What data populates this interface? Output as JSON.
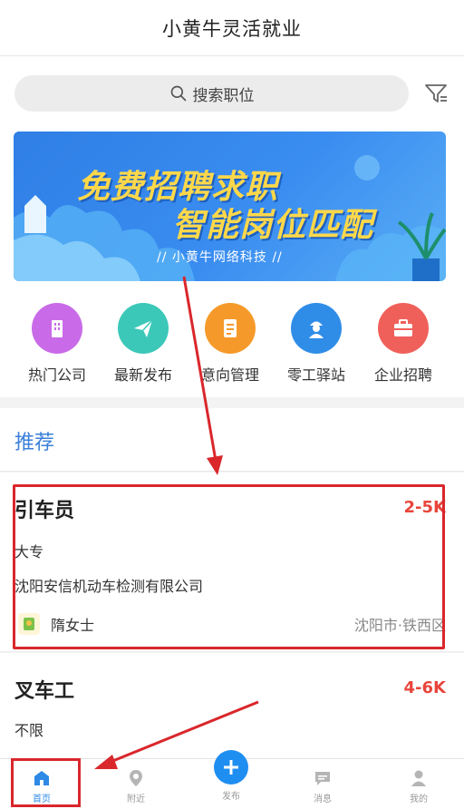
{
  "header": {
    "title": "小黄牛灵活就业"
  },
  "search": {
    "placeholder": "搜索职位"
  },
  "banner": {
    "headline1": "免费招聘求职",
    "headline2": "智能岗位匹配",
    "subtitle": "// 小黄牛网络科技 //"
  },
  "quick_links": [
    {
      "label": "热门公司",
      "icon": "building-icon",
      "color": "#c96be8"
    },
    {
      "label": "最新发布",
      "icon": "paper-plane-icon",
      "color": "#3cc8b8"
    },
    {
      "label": "意向管理",
      "icon": "document-icon",
      "color": "#f59a2a"
    },
    {
      "label": "零工驿站",
      "icon": "worker-icon",
      "color": "#2f8de8"
    },
    {
      "label": "企业招聘",
      "icon": "briefcase-icon",
      "color": "#f0605a"
    }
  ],
  "section": {
    "title": "推荐"
  },
  "jobs": [
    {
      "title": "引车员",
      "salary": "2-5K",
      "education": "大专",
      "company": "沈阳安信机动车检测有限公司",
      "contact": "隋女士",
      "location": "沈阳市·铁西区"
    },
    {
      "title": "叉车工",
      "salary": "4-6K",
      "education": "不限"
    }
  ],
  "tabbar": {
    "home": "首页",
    "nearby": "附近",
    "publish": "发布",
    "messages": "消息",
    "mine": "我的"
  },
  "colors": {
    "accent": "#2d8ae6",
    "salary": "#e8453c",
    "annotation": "#d9272c"
  }
}
